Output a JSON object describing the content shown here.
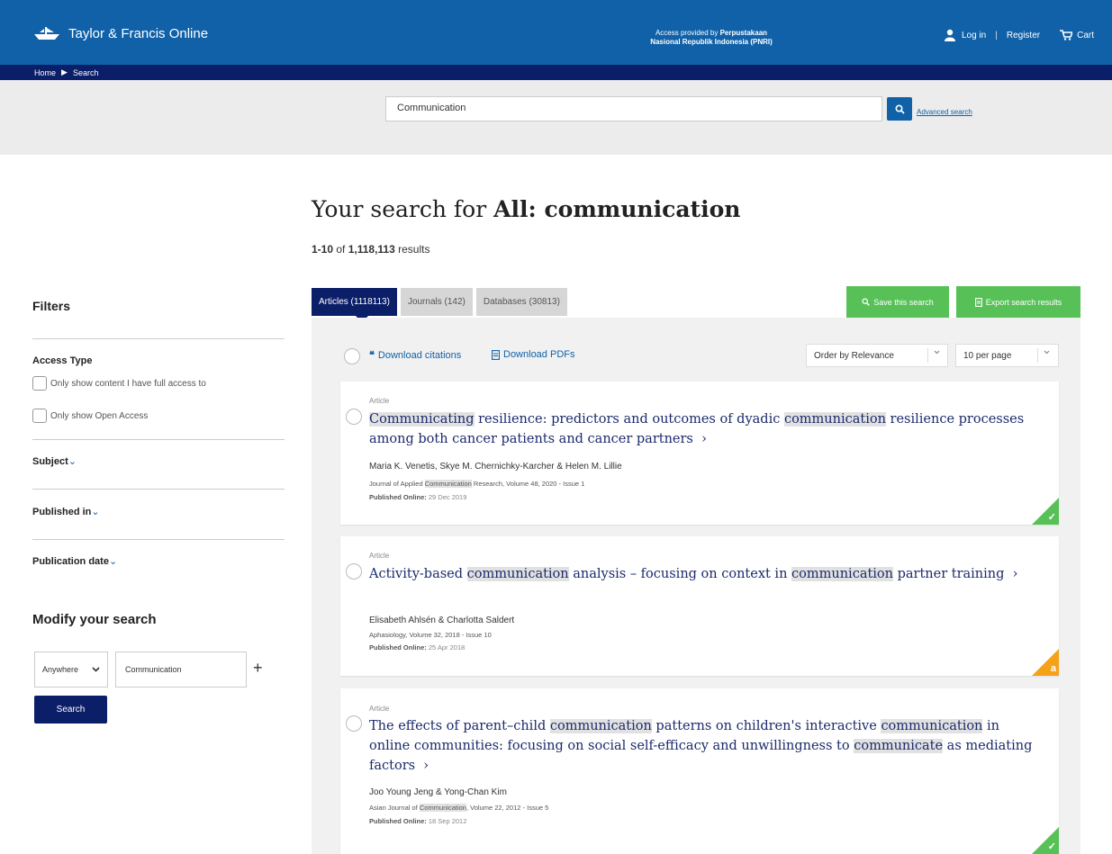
{
  "header": {
    "logo_text": "Taylor & Francis Online",
    "access_line1_prefix": "Access provided by ",
    "access_line1_org": "Perpustakaan",
    "access_line2": "Nasional Republik Indonesia (PNRI)",
    "login": "Log in",
    "divider": "|",
    "register": "Register",
    "cart": "Cart"
  },
  "breadcrumb": {
    "home": "Home",
    "current": "Search"
  },
  "search": {
    "query": "Communication",
    "advanced_link": "Advanced search"
  },
  "results_header": {
    "prefix": "Your search for ",
    "query_bold": "All: communication",
    "range": "1-10",
    "of": " of ",
    "total": "1,118,113",
    "suffix": " results"
  },
  "filters": {
    "title": "Filters",
    "access_type": "Access Type",
    "full_access": "Only show content I have full access to",
    "open_access": "Only show Open Access",
    "subject": "Subject",
    "published_in": "Published in",
    "publication_date": "Publication date",
    "facet_chevron": "⌄"
  },
  "modify": {
    "title": "Modify your search",
    "where": "Anywhere",
    "term": "Communication",
    "plus": "+",
    "search_button": "Search"
  },
  "tabs": [
    {
      "label": "Articles (1118113)"
    },
    {
      "label": "Journals (142)"
    },
    {
      "label": "Databases (30813)"
    }
  ],
  "actions": {
    "save_search": "Save this search",
    "export_results": "Export search results",
    "download_citations": "Download citations",
    "download_pdfs": "Download PDFs",
    "order_by": "Order by Relevance",
    "per_page": "10 per page"
  },
  "results": [
    {
      "kind": "Article",
      "title_parts": [
        "Communicating",
        " resilience: predictors and outcomes of dyadic ",
        "communication",
        " resilience processes among both cancer patients and cancer partners"
      ],
      "authors": "Maria K. Venetis, Skye M. Chernichky-Karcher & Helen M. Lillie",
      "journal_parts": [
        "Journal of Applied ",
        "Communication",
        " Research, Volume 48, 2020 - Issue 1"
      ],
      "published_label": "Published Online:",
      "published_date": " 29 Dec 2019",
      "access": "open",
      "access_glyph": "✓"
    },
    {
      "kind": "Article",
      "title_parts": [
        "Activity-based ",
        "communication",
        " analysis – focusing on context in ",
        "communication",
        " partner training"
      ],
      "authors": "Elisabeth Ahlsén & Charlotta Saldert",
      "journal_parts": [
        "Aphasiology, Volume 32, 2018 - Issue 10"
      ],
      "published_label": "Published Online:",
      "published_date": " 25 Apr 2018",
      "access": "restricted",
      "access_glyph": "a"
    },
    {
      "kind": "Article",
      "title_parts": [
        "The effects of parent–child ",
        "communication",
        " patterns on children's interactive ",
        "communication",
        " in online communities: focusing on social self-efficacy and unwillingness to ",
        "communicate",
        " as mediating factors"
      ],
      "authors": "Joo Young Jeng & Yong-Chan Kim",
      "journal_parts": [
        "Asian Journal of ",
        "Communication",
        ", Volume 22, 2012 - Issue 5"
      ],
      "published_label": "Published Online:",
      "published_date": " 18 Sep 2012",
      "access": "open",
      "access_glyph": "✓"
    }
  ],
  "colors": {
    "header_blue": "#1061a8",
    "navy": "#0b1e68",
    "green": "#57c157",
    "orange": "#f5a21b"
  }
}
